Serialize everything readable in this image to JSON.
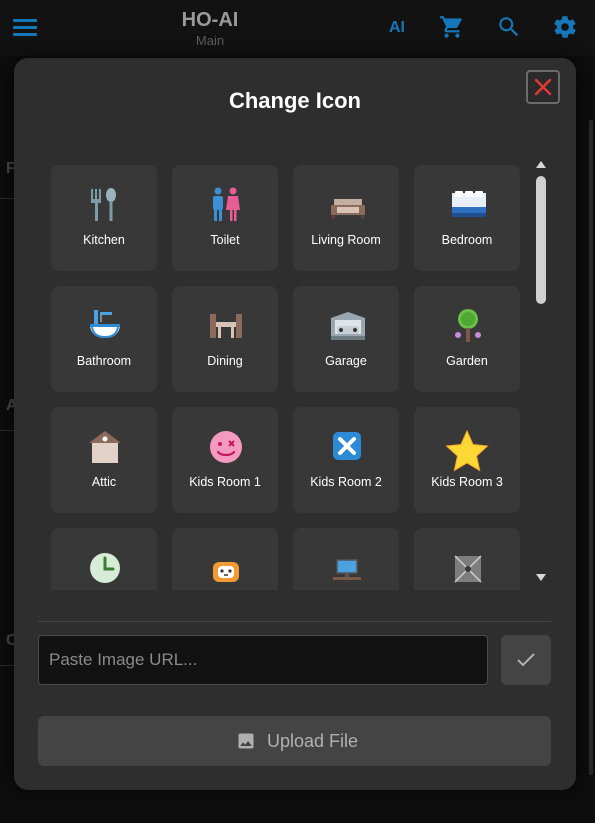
{
  "app": {
    "title": "HO-AI",
    "subtitle": "Main",
    "ai_label": "AI",
    "bg_letters": [
      "F",
      "A",
      "C"
    ]
  },
  "dialog": {
    "title": "Change Icon",
    "close_icon": "close-x-icon",
    "icons": [
      {
        "label": "Kitchen",
        "icon": "kitchen-utensils-icon"
      },
      {
        "label": "Toilet",
        "icon": "toilet-people-icon"
      },
      {
        "label": "Living Room",
        "icon": "sofa-icon"
      },
      {
        "label": "Bedroom",
        "icon": "bed-icon"
      },
      {
        "label": "Bathroom",
        "icon": "bathtub-icon"
      },
      {
        "label": "Dining",
        "icon": "dining-table-icon"
      },
      {
        "label": "Garage",
        "icon": "garage-car-icon"
      },
      {
        "label": "Garden",
        "icon": "tree-icon"
      },
      {
        "label": "Attic",
        "icon": "attic-house-icon"
      },
      {
        "label": "Kids Room 1",
        "icon": "smiley-face-icon"
      },
      {
        "label": "Kids Room 2",
        "icon": "blue-x-box-icon"
      },
      {
        "label": "Kids Room 3",
        "icon": "star-icon"
      },
      {
        "label": "",
        "icon": "clock-icon"
      },
      {
        "label": "",
        "icon": "dog-face-icon"
      },
      {
        "label": "",
        "icon": "computer-desk-icon"
      },
      {
        "label": "",
        "icon": "storage-box-icon"
      }
    ],
    "url_placeholder": "Paste Image URL...",
    "url_value": "",
    "upload_label": "Upload File"
  },
  "colors": {
    "accent": "#1677b8",
    "dialog_bg": "#2e2e2f",
    "tile_bg": "#383839",
    "close_red": "#e53935"
  }
}
